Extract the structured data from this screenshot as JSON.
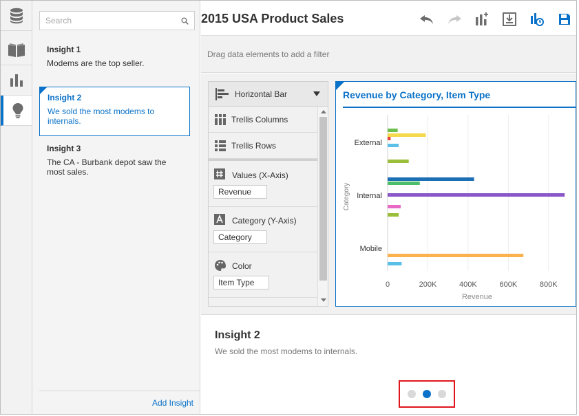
{
  "rail": {
    "items": [
      {
        "icon": "database-icon"
      },
      {
        "icon": "book-icon"
      },
      {
        "icon": "bar-chart-icon"
      },
      {
        "icon": "lightbulb-icon",
        "active": true
      }
    ]
  },
  "search": {
    "placeholder": "Search",
    "value": ""
  },
  "insights": [
    {
      "title": "Insight 1",
      "description": "Modems are the top seller."
    },
    {
      "title": "Insight 2",
      "description": "We sold the most modems to internals.",
      "selected": true
    },
    {
      "title": "Insight 3",
      "description": "The CA - Burbank depot saw the most sales."
    }
  ],
  "add_insight_label": "Add Insight",
  "page_title": "2015 USA Product Sales",
  "toolbar": [
    "undo-icon",
    "redo-icon",
    "add-visualization-icon",
    "export-icon",
    "data-refresh-icon",
    "save-icon"
  ],
  "filter_bar_text": "Drag data elements to add a filter",
  "grammar": {
    "viz_type": "Horizontal Bar",
    "trellis_columns": "Trellis Columns",
    "trellis_rows": "Trellis Rows",
    "values_label": "Values (X-Axis)",
    "values_item": "Revenue",
    "category_label": "Category (Y-Axis)",
    "category_item": "Category",
    "color_label": "Color",
    "color_item": "Item Type"
  },
  "chart_data": {
    "type": "bar",
    "orientation": "horizontal",
    "title": "Revenue by Category, Item Type",
    "xlabel": "Revenue",
    "ylabel": "Category",
    "xlim": [
      0,
      900000
    ],
    "x_ticks": [
      "0",
      "200K",
      "400K",
      "600K",
      "800K"
    ],
    "x_tick_values": [
      0,
      200000,
      400000,
      600000,
      800000
    ],
    "categories": [
      "External",
      "Internal",
      "Mobile"
    ],
    "bars": [
      {
        "category": "External",
        "color": "#6bc04b",
        "value": 50000
      },
      {
        "category": "External",
        "color": "#f5d94e",
        "value": 190000
      },
      {
        "category": "External",
        "color": "#e8453c",
        "value": 15000
      },
      {
        "category": "External",
        "color": "#5bc0e8",
        "value": 55000
      },
      {
        "category": "External",
        "color": "#9bbf3a",
        "value": 105000
      },
      {
        "category": "Internal",
        "color": "#1d6fb5",
        "value": 430000
      },
      {
        "category": "Internal",
        "color": "#4cbd6a",
        "value": 160000
      },
      {
        "category": "Internal",
        "color": "#8a56c8",
        "value": 880000
      },
      {
        "category": "Internal",
        "color": "#e76bc4",
        "value": 65000
      },
      {
        "category": "Internal",
        "color": "#9bbf3a",
        "value": 55000
      },
      {
        "category": "Mobile",
        "color": "#fbb14e",
        "value": 675000
      },
      {
        "category": "Mobile",
        "color": "#5bc0e8",
        "value": 70000
      }
    ]
  },
  "story": {
    "title": "Insight 2",
    "description": "We sold the most modems to internals.",
    "pages": 3,
    "active_page": 1
  },
  "colors": {
    "accent": "#0a72c8",
    "highlight": "#e0151b"
  }
}
